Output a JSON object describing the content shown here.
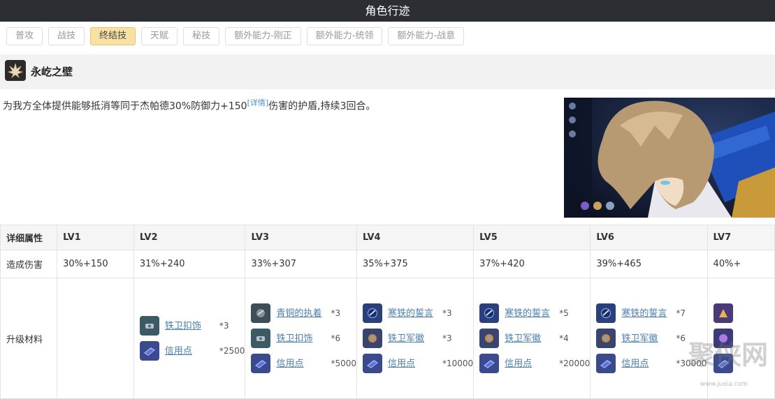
{
  "page": {
    "title": "角色行迹"
  },
  "tabs": [
    {
      "label": "普攻",
      "active": false
    },
    {
      "label": "战技",
      "active": false
    },
    {
      "label": "终结技",
      "active": true
    },
    {
      "label": "天赋",
      "active": false
    },
    {
      "label": "秘技",
      "active": false
    },
    {
      "label": "额外能力-刚正",
      "active": false
    },
    {
      "label": "额外能力-统领",
      "active": false
    },
    {
      "label": "额外能力-战意",
      "active": false
    }
  ],
  "skill": {
    "name": "永屹之壁",
    "desc_pre": "为我方全体提供能够抵消等同于杰帕德30%防御力+150",
    "detail_link": "[详情]",
    "desc_post": "伤害的护盾,持续3回合。"
  },
  "table": {
    "header_label": "详细属性",
    "levels": [
      "LV1",
      "LV2",
      "LV3",
      "LV4",
      "LV5",
      "LV6",
      "LV7"
    ],
    "damage_label": "造成伤害",
    "damage": [
      "30%+150",
      "31%+240",
      "33%+307",
      "35%+375",
      "37%+420",
      "39%+465",
      "40%+"
    ],
    "material_label": "升级材料",
    "materials": [
      [],
      [
        {
          "name": "铁卫扣饰",
          "count": "*3",
          "icon": "buckle"
        },
        {
          "name": "信用点",
          "count": "*2500",
          "icon": "credit"
        }
      ],
      [
        {
          "name": "青铜的执着",
          "count": "*3",
          "icon": "bronze"
        },
        {
          "name": "铁卫扣饰",
          "count": "*6",
          "icon": "buckle"
        },
        {
          "name": "信用点",
          "count": "*5000",
          "icon": "credit"
        }
      ],
      [
        {
          "name": "寒铁的誓言",
          "count": "*3",
          "icon": "iron"
        },
        {
          "name": "铁卫军徽",
          "count": "*3",
          "icon": "insignia"
        },
        {
          "name": "信用点",
          "count": "*10000",
          "icon": "credit"
        }
      ],
      [
        {
          "name": "寒铁的誓言",
          "count": "*5",
          "icon": "iron"
        },
        {
          "name": "铁卫军徽",
          "count": "*4",
          "icon": "insignia"
        },
        {
          "name": "信用点",
          "count": "*20000",
          "icon": "credit"
        }
      ],
      [
        {
          "name": "寒铁的誓言",
          "count": "*7",
          "icon": "iron"
        },
        {
          "name": "铁卫军徽",
          "count": "*6",
          "icon": "insignia"
        },
        {
          "name": "信用点",
          "count": "*30000",
          "icon": "credit"
        }
      ],
      [
        {
          "name": "",
          "count": "",
          "icon": "gold"
        },
        {
          "name": "",
          "count": "",
          "icon": "purple"
        },
        {
          "name": "",
          "count": "",
          "icon": "credit"
        }
      ]
    ]
  },
  "watermark": {
    "text": "聚侠网",
    "url": "www.juxia.com"
  },
  "icon_colors": {
    "buckle": "#3c5a63",
    "credit": "#3a4a8c",
    "bronze": "#3d4e58",
    "iron": "#2b3f7a",
    "insignia": "#3a4470",
    "gold": "#4a3a7a",
    "purple": "#3d3a7a"
  }
}
